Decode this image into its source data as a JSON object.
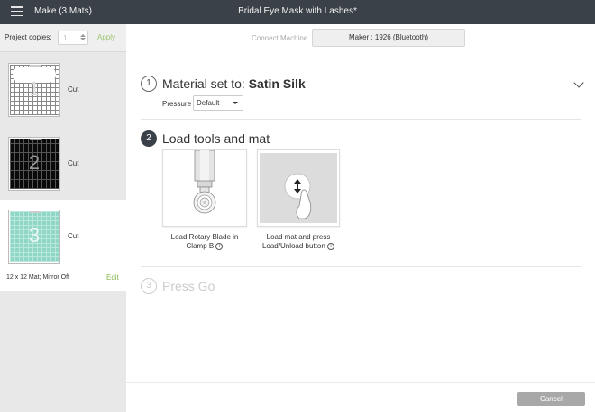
{
  "header": {
    "make_title": "Make (3 Mats)",
    "project_title": "Bridal Eye Mask with Lashes*"
  },
  "sidebar": {
    "copies_label": "Project copies:",
    "copies_value": "1",
    "apply_label": "Apply",
    "mats": [
      {
        "number": "1",
        "label": "Cut",
        "color": "#ffffff"
      },
      {
        "number": "2",
        "label": "Cut",
        "color": "#0a0a0a"
      },
      {
        "number": "3",
        "label": "Cut",
        "color": "#8fd6c6"
      }
    ],
    "selected_mat_info": "12 x 12 Mat; Mirror Off",
    "edit_label": "Edit"
  },
  "machine": {
    "connect_label": "Connect Machine",
    "machine_name": "Maker : 1926 (Bluetooth)"
  },
  "steps": {
    "step1": {
      "number": "1",
      "prefix": "Material set to: ",
      "material": "Satin Silk",
      "pressure_label": "Pressure",
      "pressure_value": "Default"
    },
    "step2": {
      "number": "2",
      "title": "Load tools and mat",
      "card1_line1": "Load Rotary Blade in",
      "card1_line2": "Clamp B",
      "card2_line1": "Load mat and press",
      "card2_line2": "Load/Unload button",
      "info_glyph": "i"
    },
    "step3": {
      "number": "3",
      "title": "Press Go"
    }
  },
  "footer": {
    "cancel_label": "Cancel"
  },
  "colors": {
    "topbar": "#3b4148",
    "accent_green": "#86b84a",
    "selected_mat_bg": "#ffffff"
  }
}
